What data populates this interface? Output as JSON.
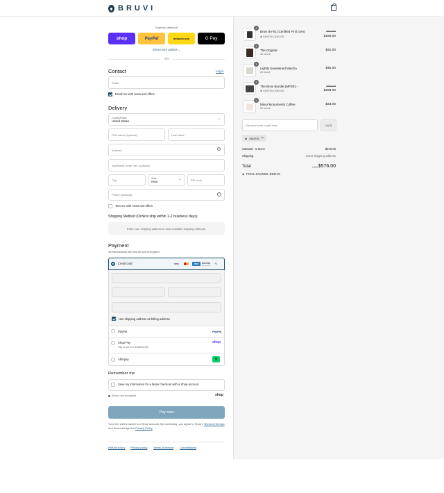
{
  "brand": {
    "name": "BRUVI"
  },
  "express": {
    "label": "Express checkout",
    "buttons": [
      "shop",
      "PayPal",
      "amazon pay",
      "G Pay"
    ],
    "show_more": "Show more options",
    "or": "OR"
  },
  "contact": {
    "heading": "Contact",
    "login": "Log in",
    "email_placeholder": "Email",
    "newsletter": "Email me with news and offers"
  },
  "delivery": {
    "heading": "Delivery",
    "country_label": "Country/Region",
    "country_value": "United States",
    "first_name": "First name (optional)",
    "last_name": "Last name",
    "address": "Address",
    "apartment": "Apartment, suite, etc. (optional)",
    "city": "City",
    "state_label": "State",
    "state_value": "Iowa",
    "zip": "ZIP code",
    "phone": "Phone (optional)",
    "text_me": "Text me with news and offers"
  },
  "shipping": {
    "heading": "Shipping Method (Orders ship within 1-2 business days)",
    "placeholder": "Enter your shipping address to view available shipping methods."
  },
  "payment": {
    "heading": "Payment",
    "subtitle": "All transactions are secure and encrypted.",
    "credit_card": "Credit card",
    "more_cards": "+1",
    "billing_same": "Use shipping address as billing address",
    "paypal": "PayPal",
    "paypal_logo": "PayPal",
    "shop_pay": "Shop Pay",
    "shop_pay_sub": "Pay in full or in installments",
    "shop_logo": "shop",
    "afterpay": "Afterpay",
    "card_logos": [
      "VISA",
      "MC",
      "AMEX",
      "DISCOVER"
    ]
  },
  "remember": {
    "heading": "Remember me",
    "save_info": "Save my information for a faster checkout with a Shop account",
    "secure": "Secure and encrypted",
    "shop": "shop"
  },
  "pay_now": "Pay now",
  "legal": {
    "line1": "Your info will be saved to a Shop account. By continuing, you agree to Shop's",
    "terms": "Terms of Service",
    "and": "and acknowledge the",
    "privacy": "Privacy Policy"
  },
  "footer_links": [
    "Refund policy",
    "Privacy policy",
    "Terms of service",
    "Cancellations"
  ],
  "cart": {
    "items": [
      {
        "qty": "1",
        "name": "Bruvi BV-01 (Certified First Gen)",
        "sub": "SAVE50 (-$50.00)",
        "original": "$219.00",
        "price": "$169.00"
      },
      {
        "qty": "1",
        "name": "The Original",
        "sub": "20 count",
        "original": "",
        "price": "$31.00"
      },
      {
        "qty": "1",
        "name": "Lightly Sweetened Matcha",
        "sub": "20 count",
        "original": "",
        "price": "$45.00"
      },
      {
        "qty": "1",
        "name": "The Bruvi Bundle (MP3R) -",
        "sub": "SAVE50 (-$50.00)",
        "original": "$348.00",
        "price": "$298.00"
      },
      {
        "qty": "1",
        "name": "Minor Monuments Coffee",
        "sub": "20 count",
        "original": "",
        "price": "$33.00"
      }
    ],
    "discount_placeholder": "Discount code or gift card",
    "apply": "Apply",
    "code": "SAVE50",
    "subtotal_label": "Subtotal · 5 items",
    "subtotal": "$576.00",
    "shipping_label": "Shipping",
    "shipping_value": "Enter shipping address",
    "total_label": "Total",
    "currency": "USD",
    "total": "$576.00",
    "savings_label": "TOTAL SAVINGS",
    "savings": "$100.00"
  },
  "colors": {
    "brand": "#1f3a4d",
    "shop": "#5a31f4",
    "paypal": "#ffc439",
    "amazon": "#ffd814",
    "gpay": "#000000",
    "pay_btn": "#7fa6bd"
  }
}
